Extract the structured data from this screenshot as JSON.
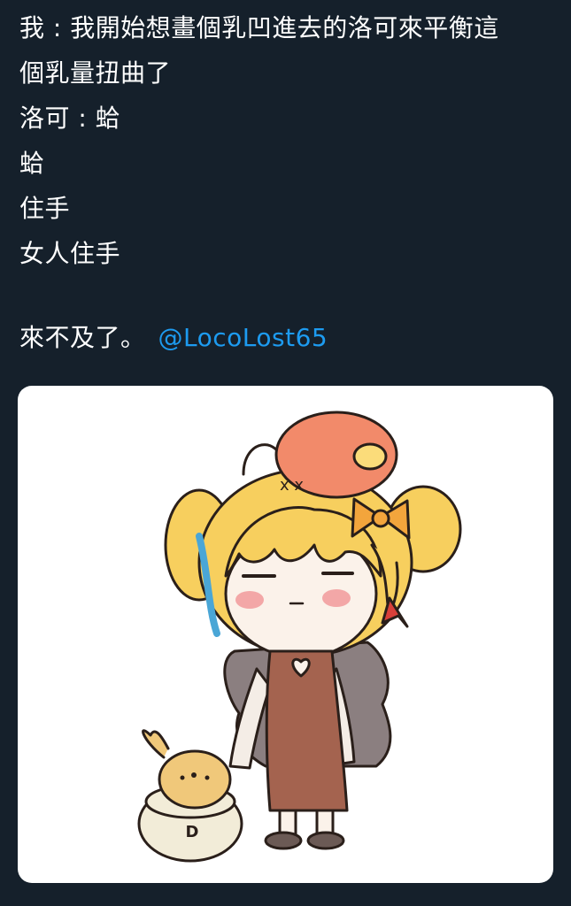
{
  "tweet": {
    "lines": [
      "我 : 我開始想畫個乳凹進去的洛可來平衡這",
      "個乳量扭曲了",
      "洛可 : 蛤",
      "蛤",
      "住手",
      "女人住手"
    ],
    "last_line_text": "來不及了。",
    "mention": "@LocoLost65"
  },
  "media": {
    "alt": "chibi drawing of a blonde girl in a brown dress with a round pet beside a bowl",
    "bowl_letter": "D"
  },
  "colors": {
    "background": "#15202b",
    "text": "#ffffff",
    "link": "#1d9bf0",
    "hair": "#f7cf5e",
    "dress": "#a4634f",
    "hat": "#f28a6a",
    "bow": "#f3a53c",
    "fur": "#8b7f80",
    "pet": "#f0c87a"
  }
}
